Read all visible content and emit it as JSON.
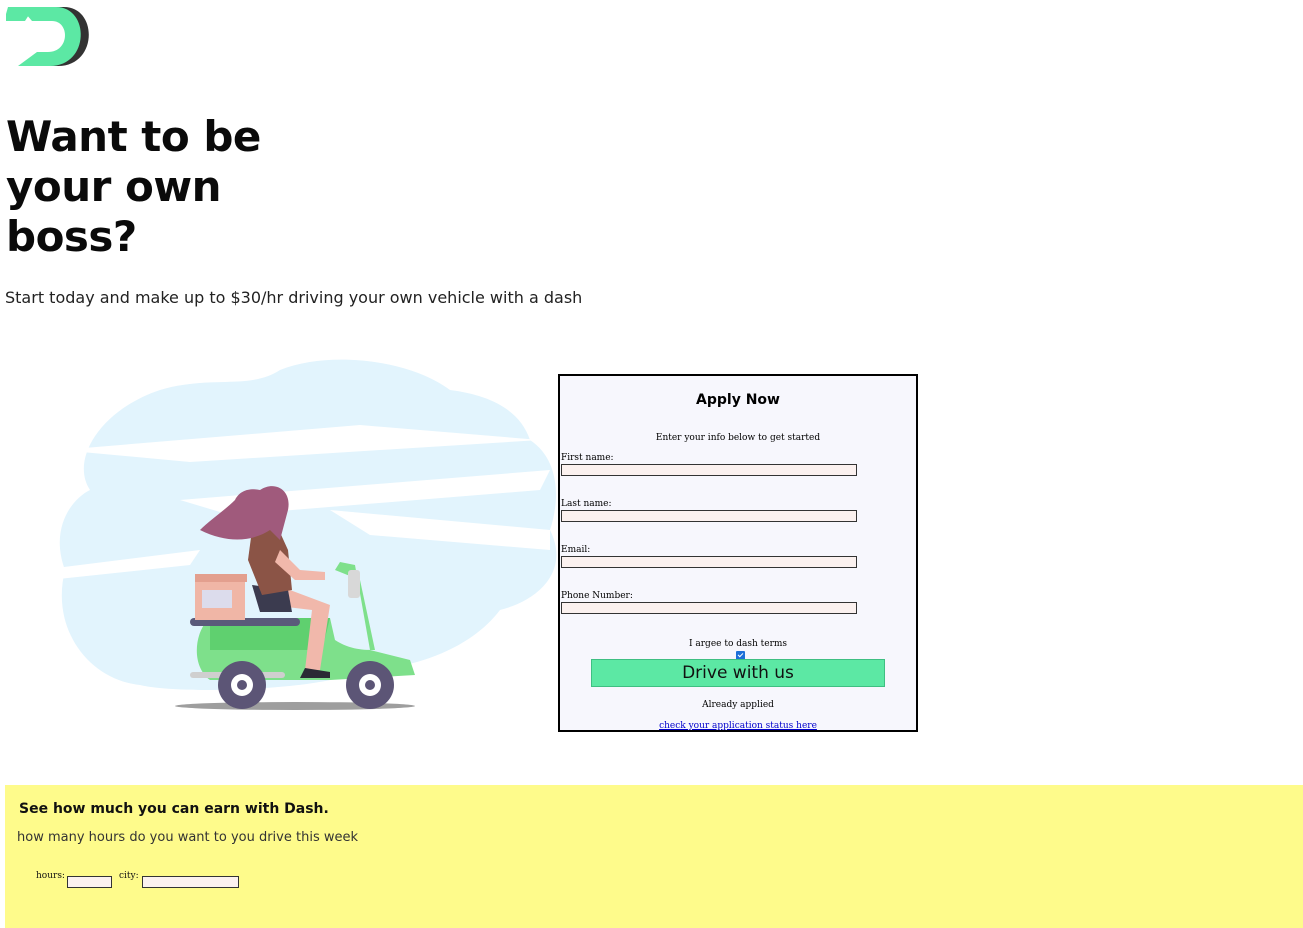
{
  "brand": {
    "logo_icon": "dash-d-logo-icon",
    "colors": {
      "green": "#5ce8a4",
      "dark": "#333333"
    }
  },
  "hero": {
    "title": "Want to be your own boss?",
    "subtitle": "Start today and make up to $30/hr driving your own vehicle with a dash"
  },
  "illustration": {
    "icon": "scooter-delivery-illustration"
  },
  "apply": {
    "title": "Apply Now",
    "intro": "Enter your info below to get started",
    "fields": [
      {
        "label": "First name:",
        "value": ""
      },
      {
        "label": "Last name:",
        "value": ""
      },
      {
        "label": "Email:",
        "value": ""
      },
      {
        "label": "Phone Number:",
        "value": ""
      }
    ],
    "terms_label": "I argee to dash terms",
    "terms_checked": true,
    "submit_label": "Drive with us",
    "already_text": "Already applied",
    "status_link": "check your application status here"
  },
  "earn": {
    "title": "See how much you can earn with Dash.",
    "subtitle": "how many hours do you want to you drive this week",
    "hours_label": "hours:",
    "hours_value": "",
    "city_label": "city:",
    "city_value": "",
    "background": "#fefb8b"
  }
}
